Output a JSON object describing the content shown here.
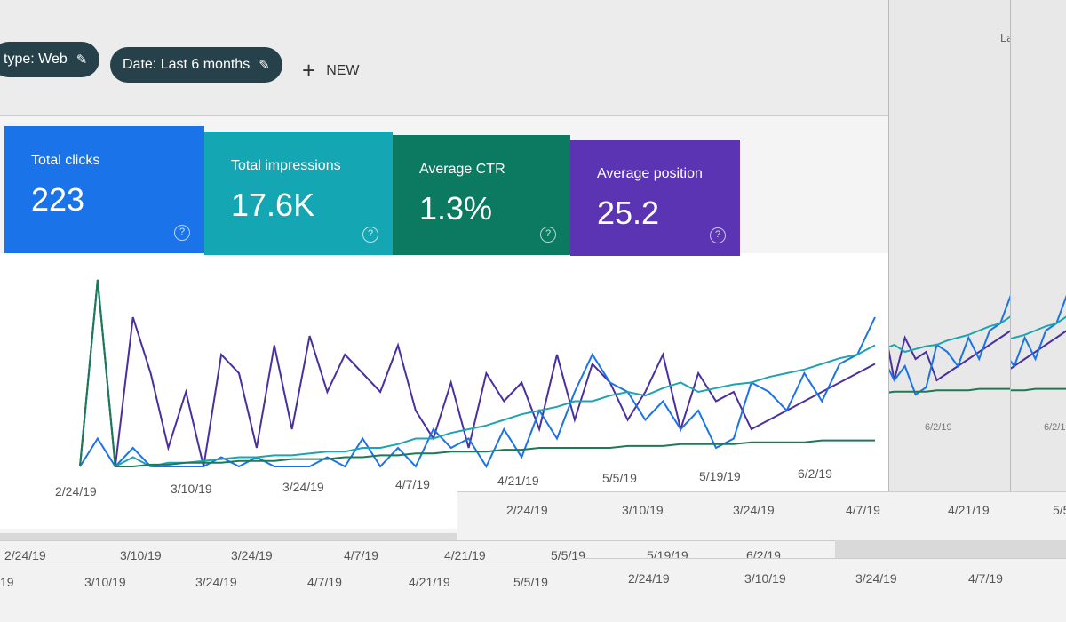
{
  "filters": {
    "type_chip": "type: Web",
    "date_chip": "Date: Last 6 months",
    "new_label": "NEW"
  },
  "metrics": [
    {
      "label": "Total clicks",
      "value": "223",
      "color": "#1a73e8"
    },
    {
      "label": "Total impressions",
      "value": "17.6K",
      "color": "#14a6b2"
    },
    {
      "label": "Average CTR",
      "value": "1.3%",
      "color": "#0b7a60"
    },
    {
      "label": "Average position",
      "value": "25.2",
      "color": "#5a34b3"
    }
  ],
  "side_labels": {
    "la": "La",
    "date": "6/2/19"
  },
  "chart_data": {
    "type": "line",
    "x_ticks": [
      "2/24/19",
      "3/10/19",
      "3/24/19",
      "4/7/19",
      "4/21/19",
      "5/5/19",
      "5/19/19",
      "6/2/19"
    ],
    "ylim": [
      0,
      100
    ],
    "series": [
      {
        "color": "#4a2fa0",
        "values": [
          0,
          100,
          0,
          80,
          50,
          10,
          40,
          0,
          60,
          50,
          10,
          65,
          20,
          70,
          40,
          60,
          50,
          40,
          65,
          30,
          15,
          45,
          10,
          50,
          35,
          45,
          20,
          60,
          25,
          55,
          45,
          25,
          40,
          60,
          20,
          50,
          35,
          40,
          20,
          25,
          30,
          35,
          40,
          45,
          50,
          55
        ]
      },
      {
        "color": "#1a73e8",
        "values": [
          0,
          15,
          0,
          10,
          0,
          0,
          0,
          0,
          5,
          0,
          5,
          0,
          0,
          0,
          5,
          0,
          15,
          0,
          10,
          0,
          20,
          10,
          15,
          0,
          20,
          5,
          30,
          15,
          40,
          60,
          45,
          40,
          25,
          35,
          20,
          30,
          10,
          15,
          45,
          40,
          30,
          50,
          35,
          55,
          60,
          80
        ]
      },
      {
        "color": "#1fa3b0",
        "values": [
          0,
          100,
          0,
          5,
          0,
          2,
          2,
          3,
          4,
          5,
          5,
          6,
          6,
          7,
          8,
          8,
          10,
          10,
          12,
          15,
          15,
          18,
          20,
          22,
          25,
          28,
          30,
          32,
          35,
          35,
          38,
          40,
          38,
          42,
          45,
          40,
          42,
          44,
          45,
          48,
          50,
          52,
          55,
          58,
          60,
          65
        ]
      },
      {
        "color": "#1e7a55",
        "values": [
          0,
          100,
          0,
          0,
          1,
          1,
          2,
          2,
          2,
          3,
          3,
          3,
          4,
          4,
          4,
          5,
          5,
          6,
          6,
          7,
          7,
          8,
          8,
          8,
          9,
          9,
          10,
          10,
          10,
          10,
          10,
          11,
          11,
          11,
          12,
          12,
          12,
          12,
          13,
          13,
          13,
          13,
          14,
          14,
          14,
          14
        ]
      }
    ]
  },
  "strip_a": [
    "2/24/19",
    "3/10/19",
    "3/24/19",
    "4/7/19",
    "4/21/19",
    "5/5"
  ],
  "strip_b": [
    "2/24/19",
    "3/10/19",
    "3/24/19",
    "4/7/19",
    "4/21/19",
    "5/5/19",
    "5/19/19",
    "6/2/19"
  ],
  "strip_c": [
    "19",
    "3/10/19",
    "3/24/19",
    "4/7/19",
    "4/21/19",
    "5/5/19"
  ],
  "strip_d": [
    "2/24/19",
    "3/10/19",
    "3/24/19",
    "4/7/19"
  ]
}
